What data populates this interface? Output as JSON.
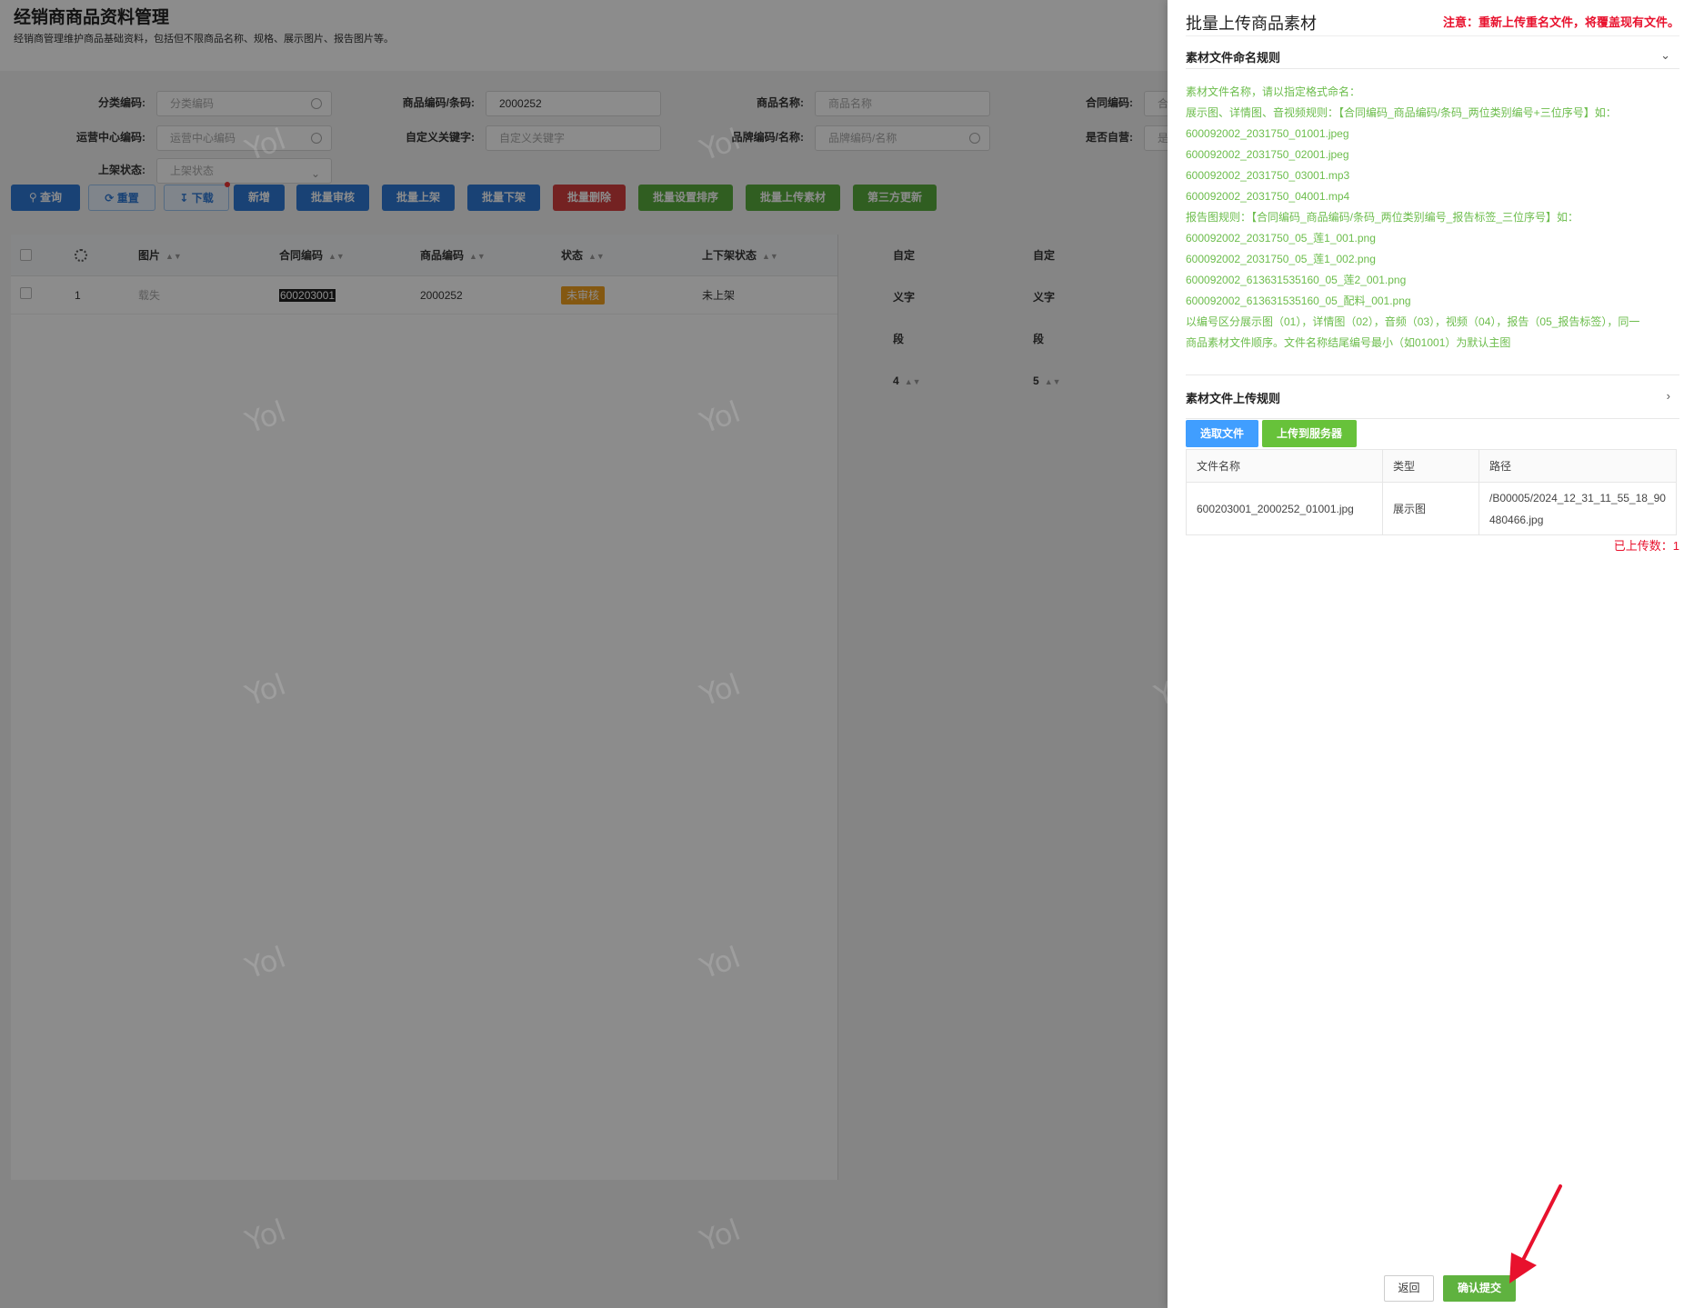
{
  "page": {
    "title": "经销商商品资料管理",
    "subtitle": "经销商管理维护商品基础资料，包括但不限商品名称、规格、展示图片、报告图片等。"
  },
  "filters": {
    "category_label": "分类编码:",
    "category_placeholder": "分类编码",
    "product_code_label": "商品编码/条码:",
    "product_code_value": "2000252",
    "product_name_label": "商品名称:",
    "product_name_placeholder": "商品名称",
    "contract_label": "合同编码:",
    "contract_placeholder": "合",
    "ops_center_label": "运营中心编码:",
    "ops_center_placeholder": "运营中心编码",
    "custom_keyword_label": "自定义关键字:",
    "custom_keyword_placeholder": "自定义关键字",
    "brand_label": "品牌编码/名称:",
    "brand_placeholder": "品牌编码/名称",
    "self_operated_label": "是否自营:",
    "self_operated_placeholder": "是",
    "shelf_status_label": "上架状态:",
    "shelf_status_placeholder": "上架状态"
  },
  "toolbar": {
    "query": "查询",
    "reset": "重置",
    "download": "下载",
    "add": "新增",
    "batch_review": "批量审核",
    "batch_list": "批量上架",
    "batch_delist": "批量下架",
    "batch_delete": "批量删除",
    "batch_sort": "批量设置排序",
    "batch_upload": "批量上传素材",
    "third_party_update": "第三方更新"
  },
  "table": {
    "headers": [
      "图片",
      "合同编码",
      "商品编码",
      "状态",
      "上下架状态",
      "自定义字段4",
      "自定义字段5"
    ],
    "rows": [
      {
        "index": "1",
        "image": "载失",
        "contract_code": "600203001",
        "product_code": "2000252",
        "status": "未审核",
        "shelf_status": "未上架"
      }
    ]
  },
  "watermark": "Yol",
  "drawer": {
    "title": "批量上传商品素材",
    "warning": "注意：重新上传重名文件，将覆盖现有文件。",
    "naming_rule_title": "素材文件命名规则",
    "rules": [
      "素材文件名称，请以指定格式命名：",
      "展示图、详情图、音视频规则：【合同编码_商品编码/条码_两位类别编号+三位序号】如：",
      "600092002_2031750_01001.jpeg",
      "600092002_2031750_02001.jpeg",
      "600092002_2031750_03001.mp3",
      "600092002_2031750_04001.mp4",
      "报告图规则：【合同编码_商品编码/条码_两位类别编号_报告标签_三位序号】如：",
      "600092002_2031750_05_莲1_001.png",
      "600092002_2031750_05_莲1_002.png",
      "600092002_613631535160_05_莲2_001.png",
      "600092002_613631535160_05_配料_001.png",
      "以编号区分展示图（01），详情图（02），音频（03），视频（04），报告（05_报告标签），同一",
      "商品素材文件顺序。文件名称结尾编号最小（如01001）为默认主图"
    ],
    "upload_rule_title": "素材文件上传规则",
    "select_file": "选取文件",
    "upload_server": "上传到服务器",
    "file_table": {
      "headers": [
        "文件名称",
        "类型",
        "路径"
      ],
      "rows": [
        {
          "name": "600203001_2000252_01001.jpg",
          "type": "展示图",
          "path_line1": "/B00005/2024_12_31_11_55_18_90",
          "path_line2": "480466.jpg"
        }
      ]
    },
    "uploaded_count": "已上传数：1",
    "back": "返回",
    "submit": "确认提交"
  },
  "colors": {
    "accent_blue": "#2e79d6",
    "green": "#58ab3c",
    "danger_red": "#e8112d",
    "rule_green": "#6cbd4c"
  }
}
